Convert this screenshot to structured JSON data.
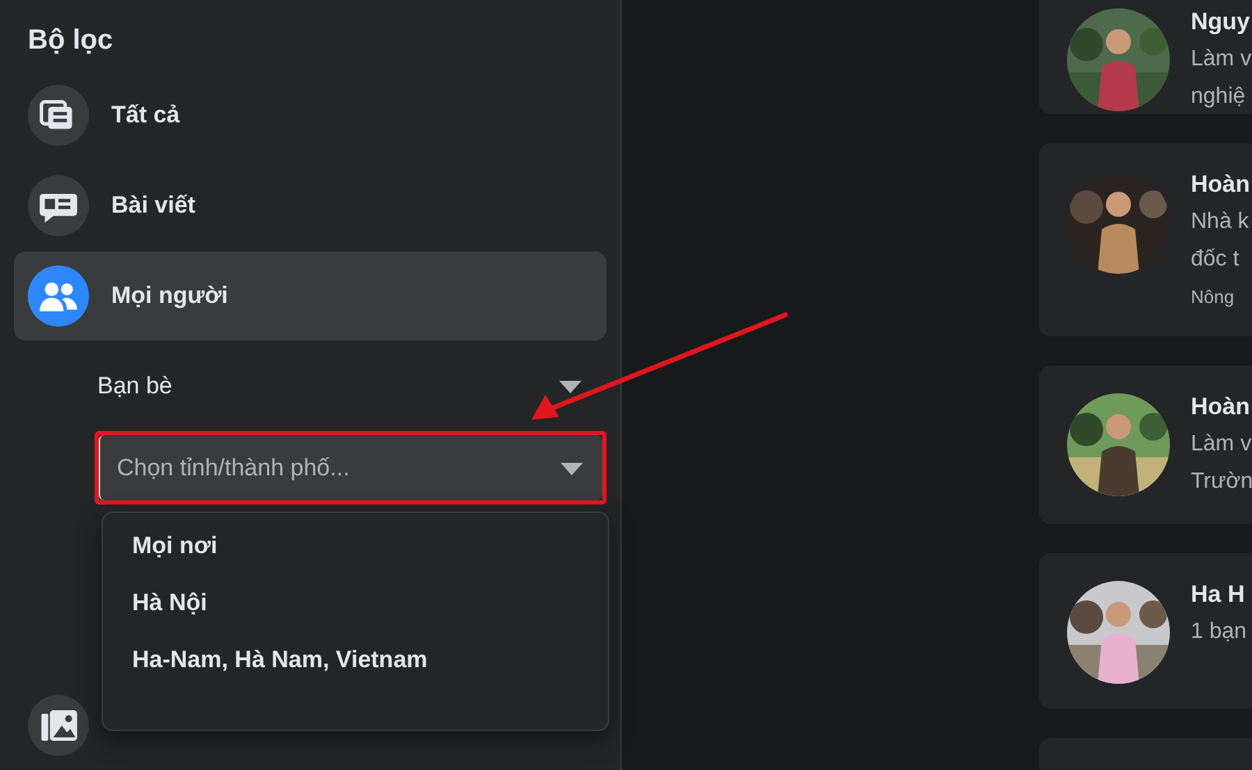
{
  "sidebar": {
    "title": "Bộ lọc",
    "items": [
      {
        "kind": "all",
        "label": "Tất cả",
        "selected": false
      },
      {
        "kind": "posts",
        "label": "Bài viết",
        "selected": false
      },
      {
        "kind": "people",
        "label": "Mọi người",
        "selected": true
      }
    ],
    "sub_filters": [
      {
        "label": "Bạn bè"
      }
    ],
    "city_field": {
      "placeholder": "Chọn tỉnh/thành phố...",
      "highlighted": true
    },
    "city_options": [
      "Mọi nơi",
      "Hà Nội",
      "Ha-Nam, Hà Nam, Vietnam"
    ],
    "bottom_item": {
      "kind": "photos"
    }
  },
  "annotation": {
    "kind": "arrow"
  },
  "results": [
    {
      "name": "Nguy",
      "lines": [
        "Làm v",
        "nghiệ"
      ]
    },
    {
      "name": "Hoàn",
      "lines": [
        "Nhà k",
        "đốc t"
      ],
      "extra": "Nông"
    },
    {
      "name": "Hoàn",
      "lines": [
        "Làm v",
        "Trườn"
      ]
    },
    {
      "name": "Ha H",
      "lines": [
        "1 bạn"
      ]
    },
    {
      "kind": "empty"
    }
  ]
}
